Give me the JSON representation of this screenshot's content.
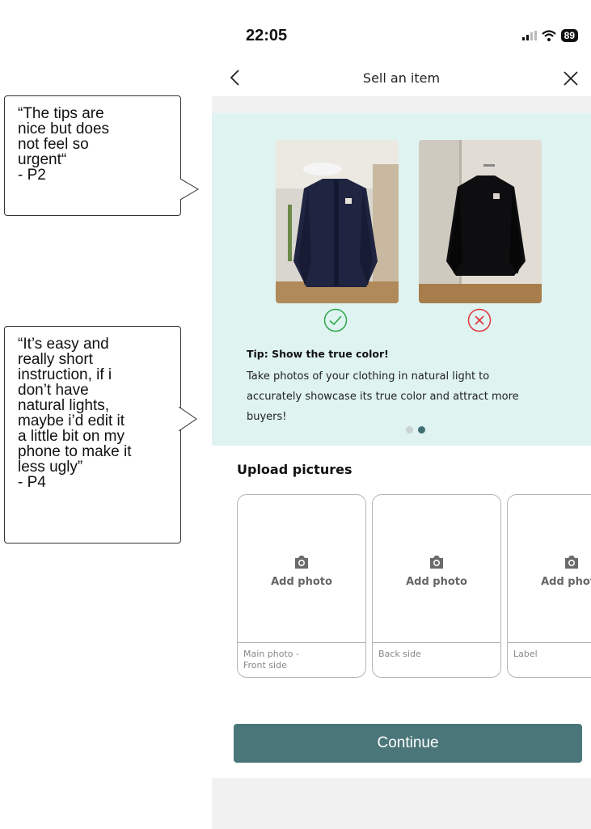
{
  "annotations": [
    {
      "lines": [
        "“The tips are",
        "nice but does",
        "not feel so",
        "urgent“",
        "- P2"
      ]
    },
    {
      "lines": [
        "“It’s easy and",
        "really short",
        "instruction, if i",
        "don’t have",
        "natural lights,",
        "maybe i’d edit it",
        "a little bit on my",
        "phone to make it",
        "less ugly”",
        "- P4"
      ]
    }
  ],
  "status_bar": {
    "time": "22:05",
    "battery": "89",
    "icons": [
      "signal-icon",
      "wifi-icon",
      "battery-icon"
    ]
  },
  "nav": {
    "title": "Sell an item",
    "back_icon": "chevron-left-icon",
    "close_icon": "close-icon"
  },
  "tip": {
    "good_icon": "check-circle-icon",
    "bad_icon": "x-circle-icon",
    "title": "Tip: Show the true color!",
    "body_lines": [
      "Take photos of your clothing in natural light to",
      "accurately showcase its true color and attract more",
      "buyers!"
    ],
    "carousel": {
      "count": 2,
      "active": 2
    }
  },
  "upload": {
    "title": "Upload pictures",
    "cards": [
      {
        "add_label": "Add photo",
        "caption_lines": [
          "Main photo -",
          "Front side"
        ]
      },
      {
        "add_label": "Add photo",
        "caption_lines": [
          "Back side"
        ]
      },
      {
        "add_label": "Add photo",
        "caption_lines": [
          "Label"
        ]
      }
    ]
  },
  "continue_label": "Continue",
  "colors": {
    "accent": "#4a767a",
    "tip_bg": "#dff3f1",
    "good": "#2ea84a",
    "bad": "#e0343b"
  }
}
